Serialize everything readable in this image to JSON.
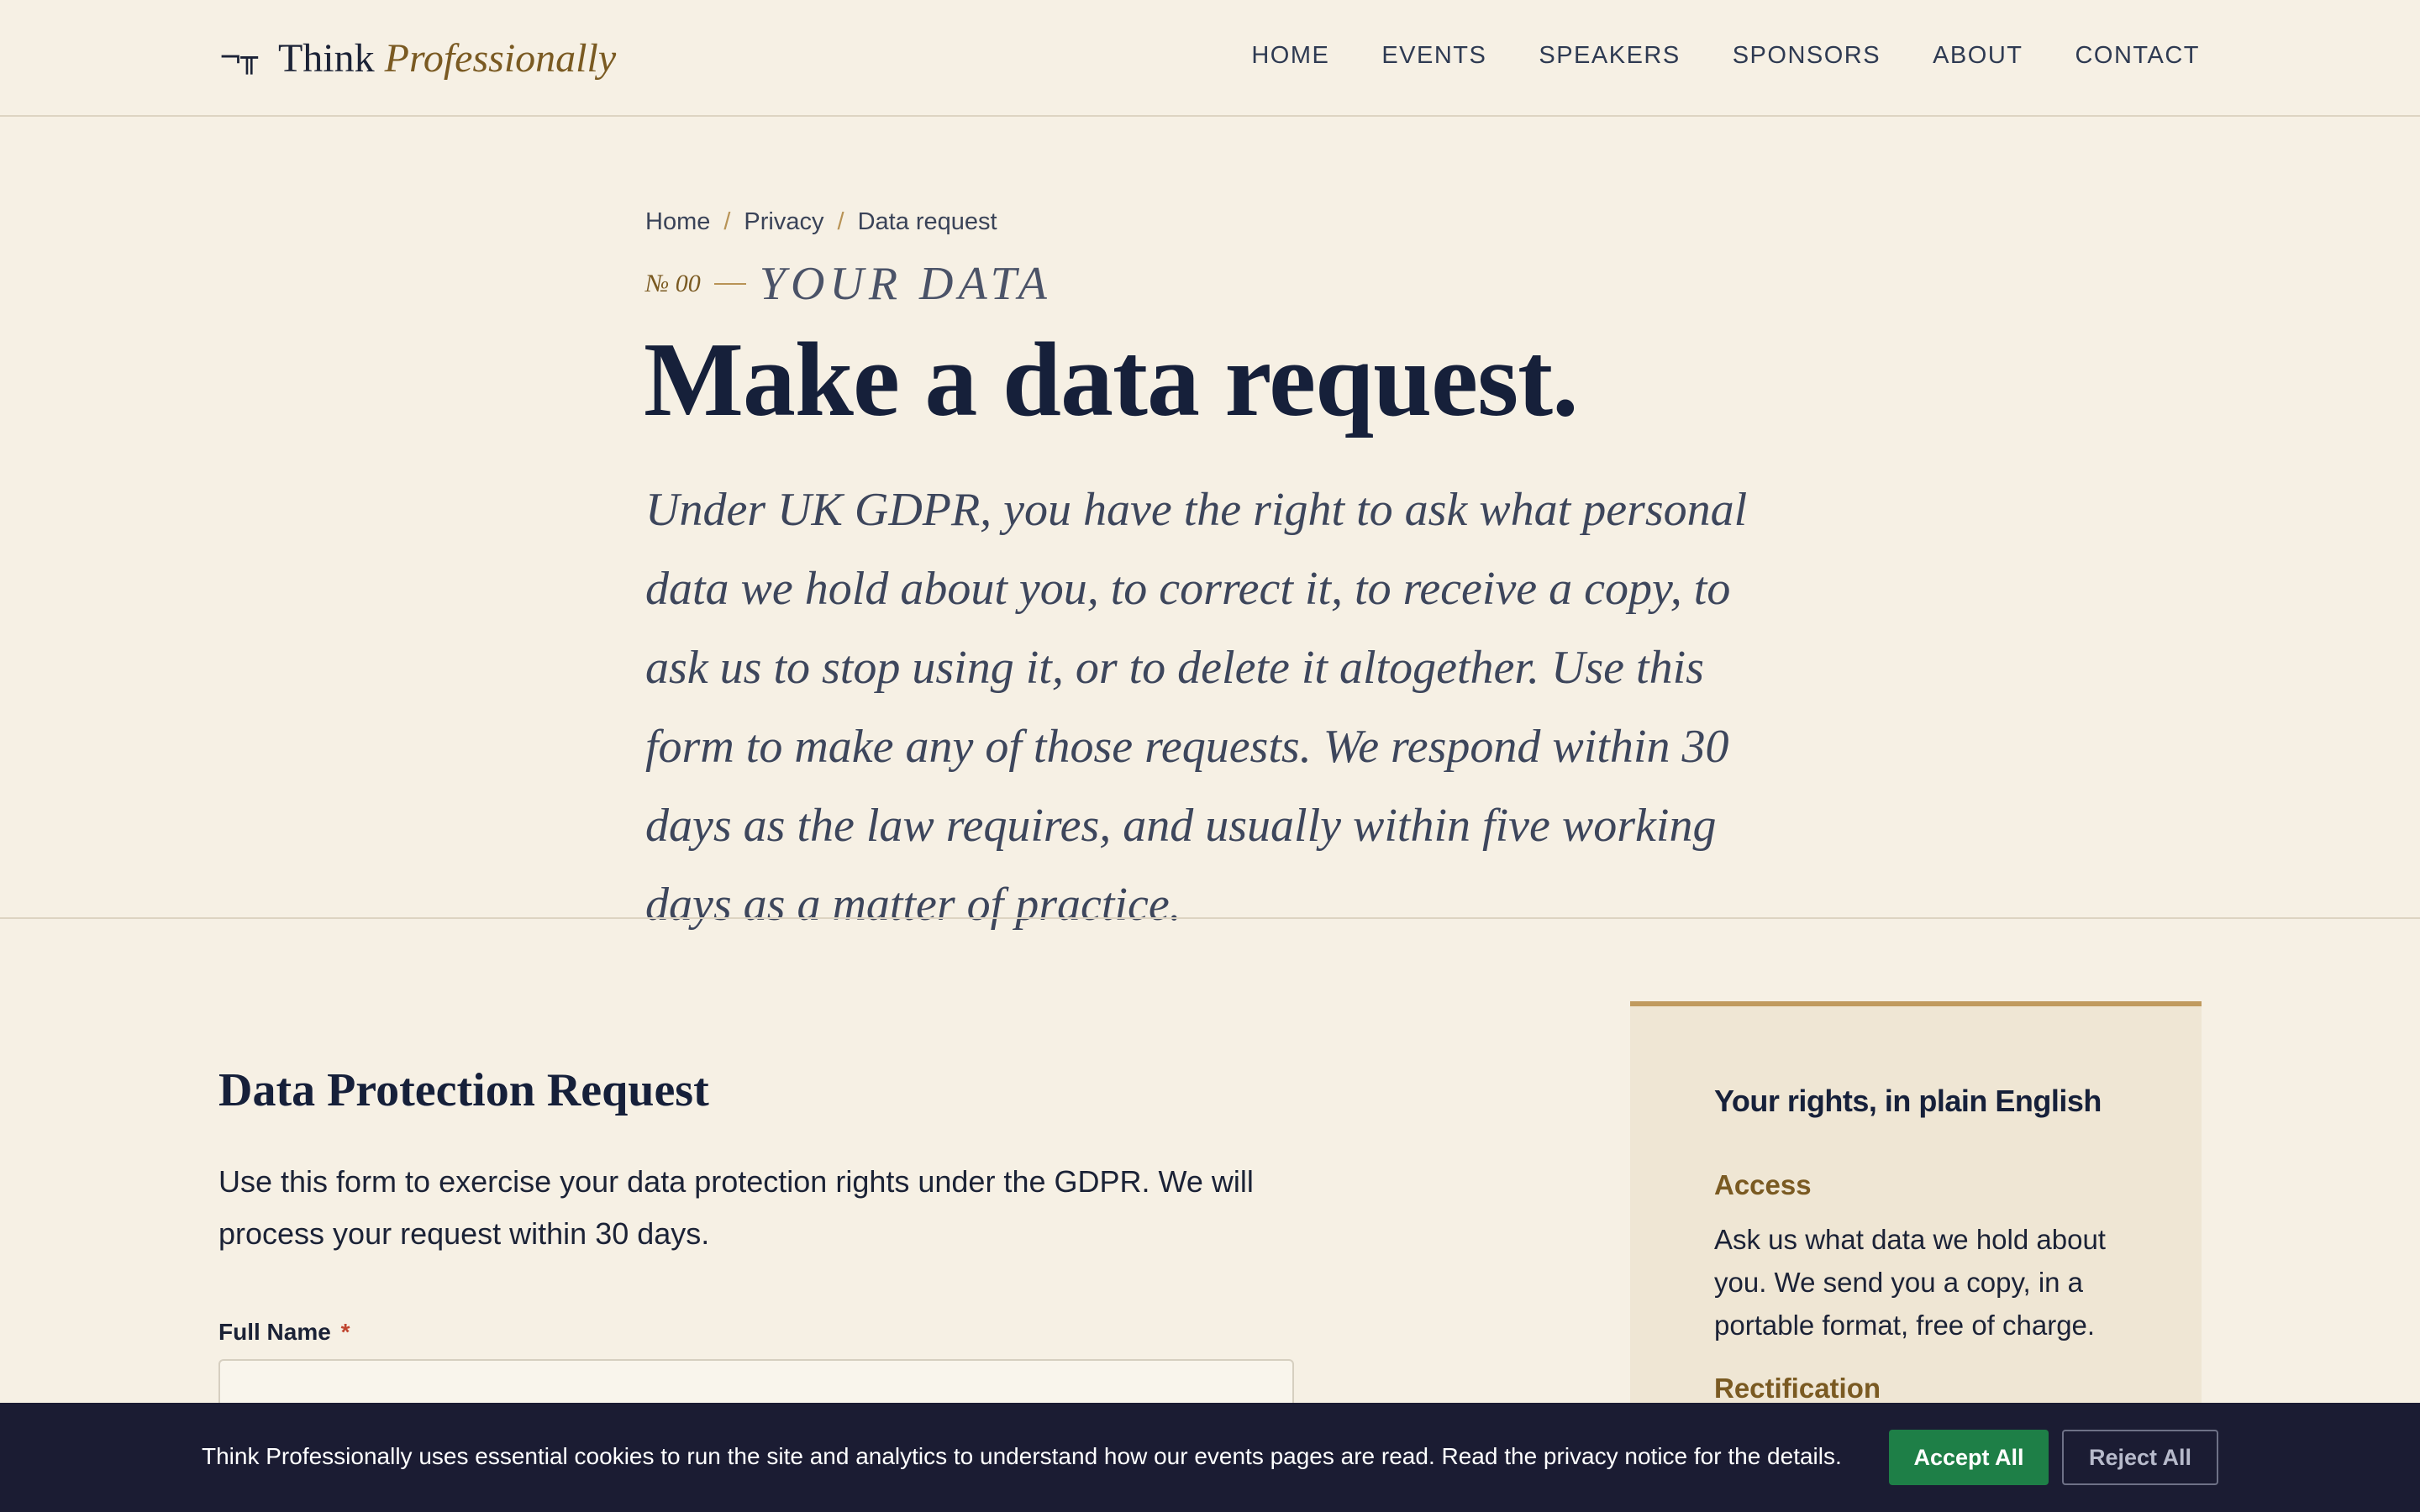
{
  "header": {
    "logo_mark": "¬╥",
    "logo_think": "Think",
    "logo_pro": "Professionally",
    "nav": [
      "HOME",
      "EVENTS",
      "SPEAKERS",
      "SPONSORS",
      "ABOUT",
      "CONTACT"
    ]
  },
  "breadcrumb": {
    "items": [
      "Home",
      "Privacy",
      "Data request"
    ],
    "separator": "/"
  },
  "hero": {
    "number": "№ 00",
    "eyebrow": "YOUR DATA",
    "title": "Make a data request.",
    "lead": "Under UK GDPR, you have the right to ask what personal data we hold about you, to correct it, to receive a copy, to ask us to stop using it, or to delete it altogether. Use this form to make any of those requests. We respond within 30 days as the law requires, and usually within five working days as a matter of practice."
  },
  "form": {
    "title": "Data Protection Request",
    "description": "Use this form to exercise your data protection rights under the GDPR. We will process your request within 30 days.",
    "full_name_label": "Full Name",
    "required_mark": "*",
    "full_name_value": ""
  },
  "aside": {
    "title": "Your rights, in plain English",
    "items": [
      {
        "title": "Access",
        "body": "Ask us what data we hold about you. We send you a copy, in a portable format, free of charge."
      },
      {
        "title": "Rectification",
        "body": ""
      }
    ]
  },
  "cookie": {
    "text": "Think Professionally uses essential cookies to run the site and analytics to understand how our events pages are read. Read the privacy notice for the details.",
    "accept_label": "Accept All",
    "reject_label": "Reject All"
  },
  "colors": {
    "background": "#f6f0e4",
    "accent": "#7a5a22",
    "accept": "#1e7f47",
    "banner": "#1b1c33"
  }
}
